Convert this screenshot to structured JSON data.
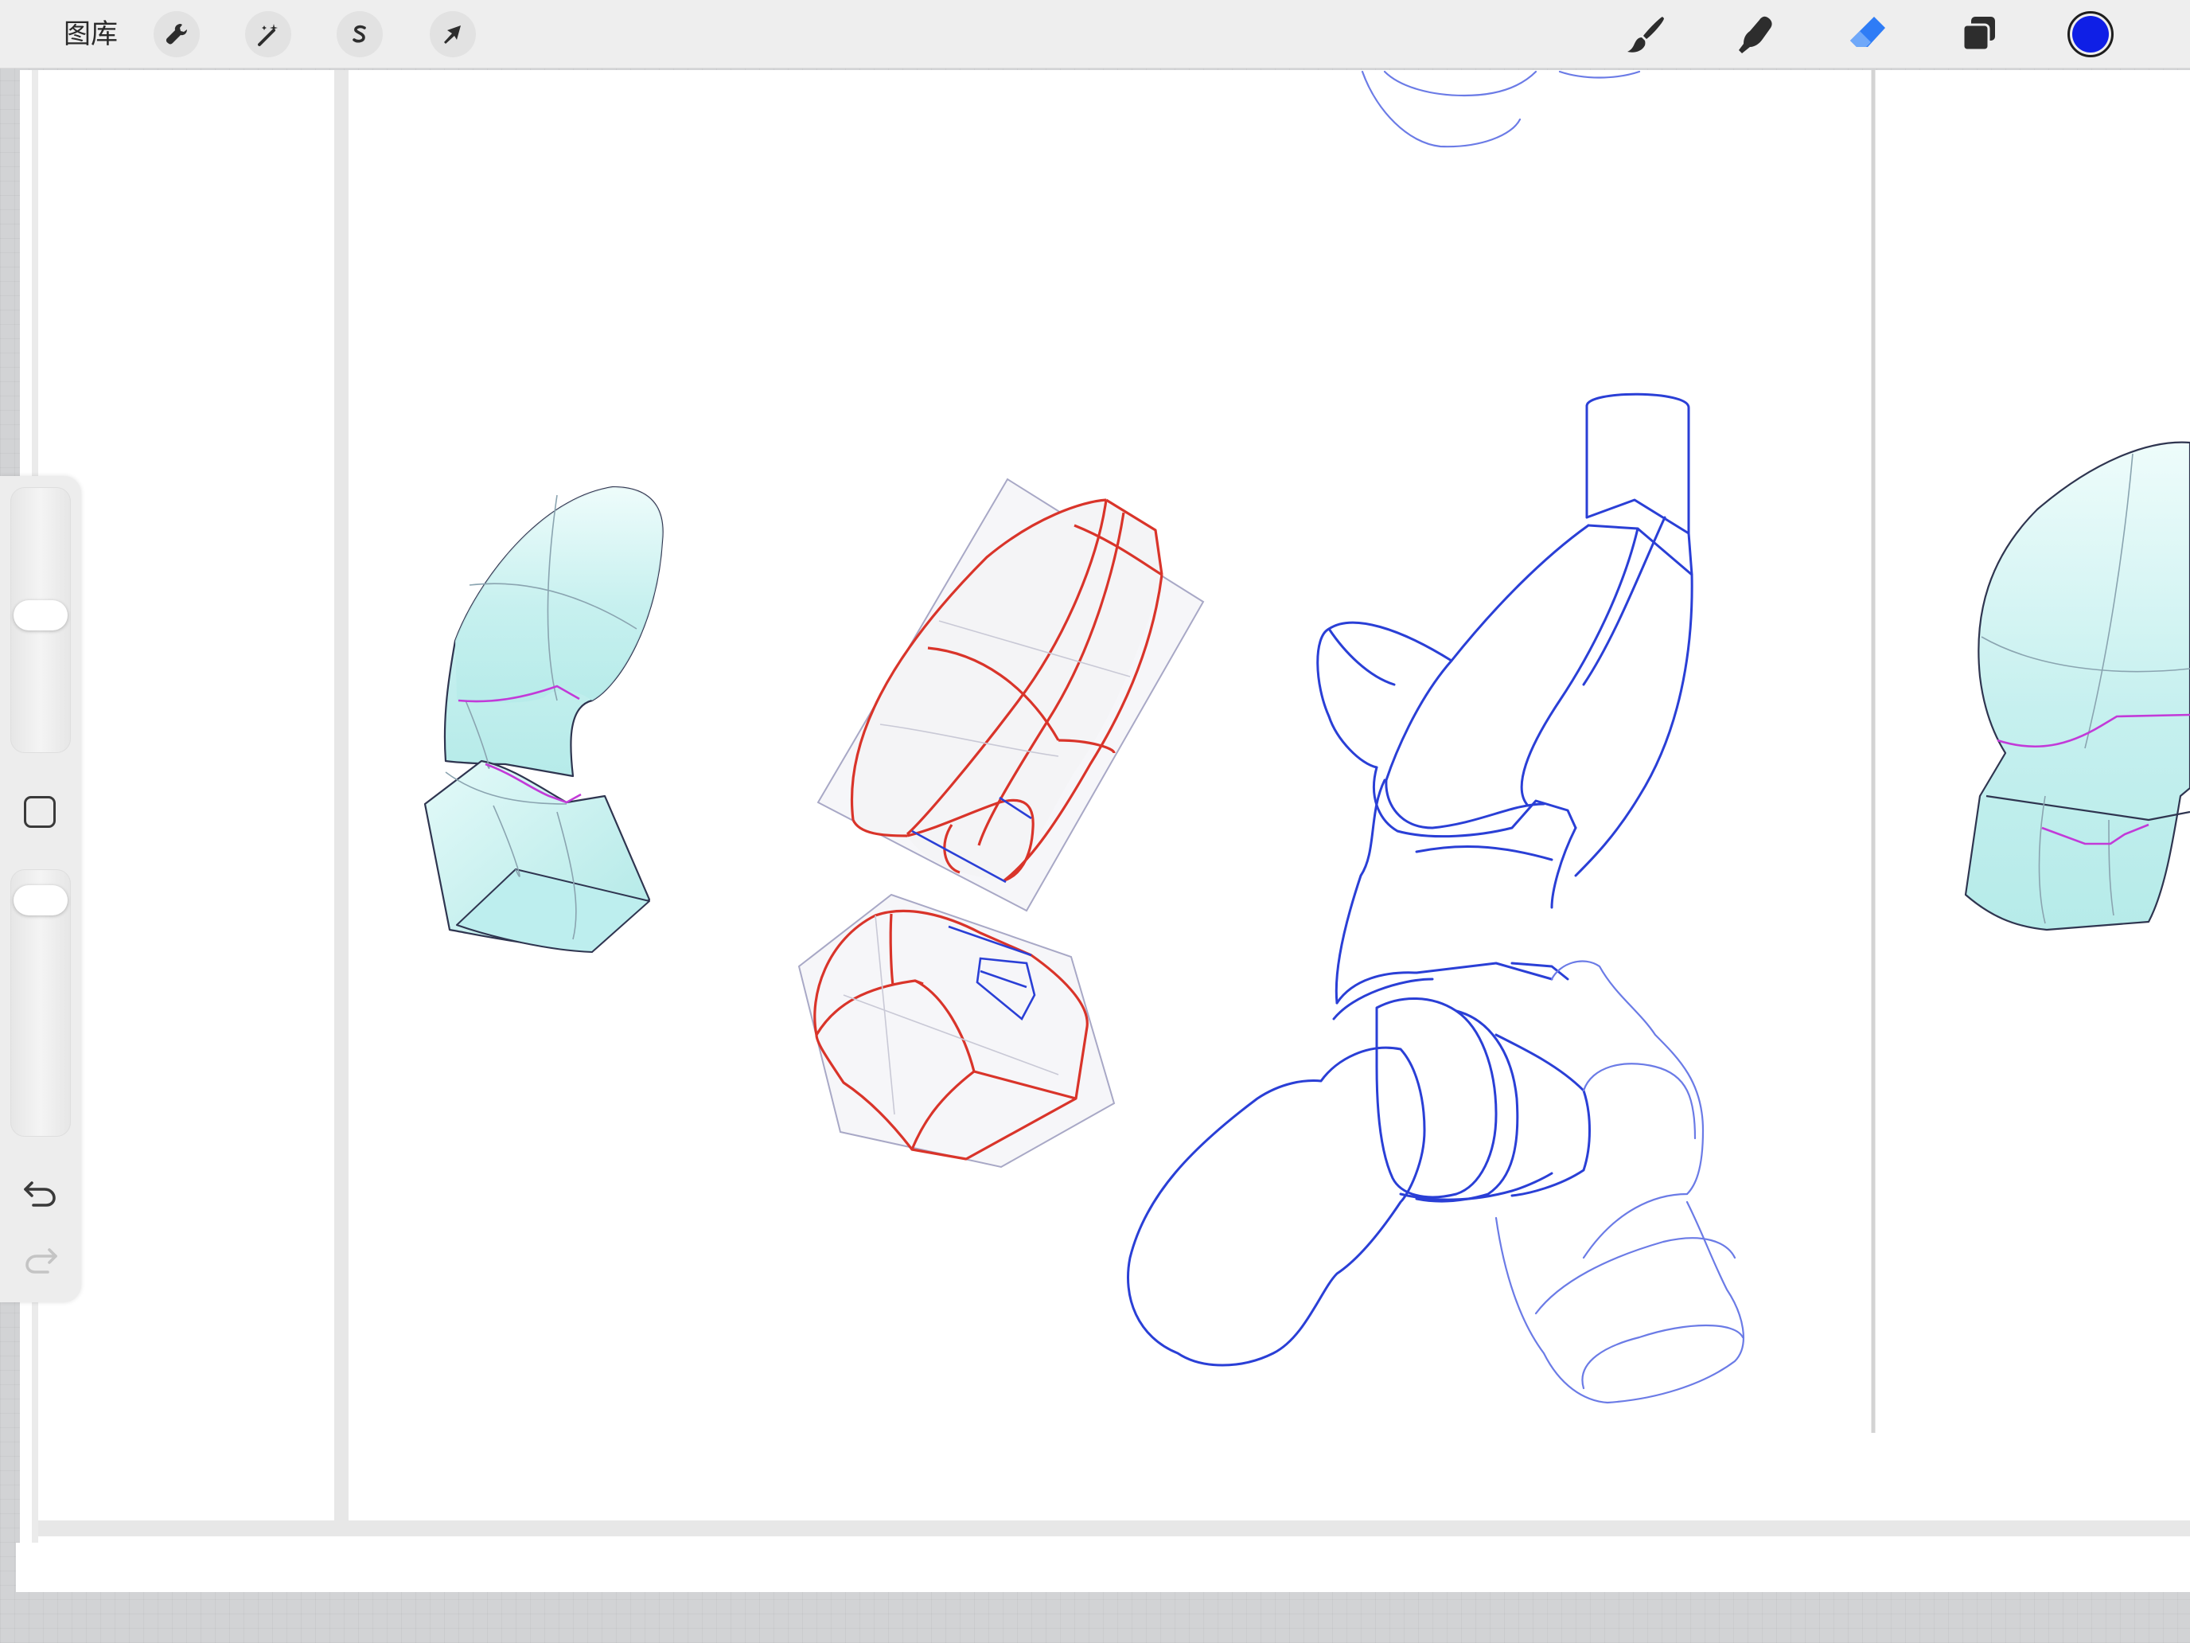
{
  "toolbar": {
    "gallery_label": "图库",
    "left_tools": [
      {
        "name": "actions",
        "icon": "wrench-icon"
      },
      {
        "name": "adjustments",
        "icon": "magic-wand-icon"
      },
      {
        "name": "selection",
        "icon": "selection-s-icon"
      },
      {
        "name": "transform",
        "icon": "arrow-cursor-icon"
      }
    ],
    "right_tools": [
      {
        "name": "brush",
        "icon": "brush-icon",
        "active": false
      },
      {
        "name": "smudge",
        "icon": "smudge-finger-icon",
        "active": false
      },
      {
        "name": "eraser",
        "icon": "eraser-icon",
        "active": true
      },
      {
        "name": "layers",
        "icon": "layers-icon",
        "active": false
      }
    ],
    "current_color": "#0f1fe6"
  },
  "sidebar": {
    "brush_size_level": 0.52,
    "opacity_level": 0.05,
    "modify_icon": "square-outline-icon",
    "undo_icon": "undo-arrow-icon",
    "redo_icon": "redo-arrow-icon"
  },
  "colors": {
    "toolbar_bg": "#eeeeee",
    "active_tool": "#2e7cf6",
    "sketch_blue": "#2a3fd6",
    "construction_red": "#d9342a",
    "fill_cyan": "#c9f2f0",
    "accent_magenta": "#c23ad8",
    "guide_gray": "#a9a9c4"
  }
}
